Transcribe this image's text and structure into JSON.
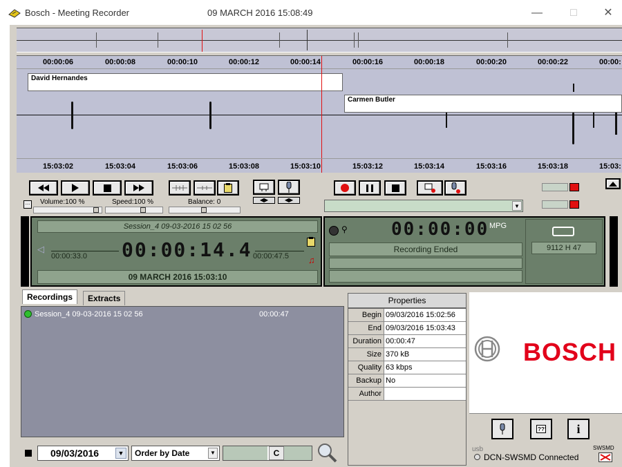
{
  "window": {
    "title": "Bosch - Meeting Recorder",
    "datetime": "09 MARCH 2016 15:08:49",
    "minimize": "—",
    "maximize": "□",
    "close": "✕"
  },
  "timeline": {
    "top_ticks": [
      "00:00:06",
      "00:00:08",
      "00:00:10",
      "00:00:12",
      "00:00:14",
      "00:00:16",
      "00:00:18",
      "00:00:20",
      "00:00:22",
      "00:00:"
    ],
    "bottom_ticks": [
      "15:03:02",
      "15:03:04",
      "15:03:06",
      "15:03:08",
      "15:03:10",
      "15:03:12",
      "15:03:14",
      "15:03:16",
      "15:03:18",
      "15:03:"
    ],
    "speakers": [
      "David Hernandes",
      "Carmen Butler"
    ]
  },
  "playback": {
    "volume_label": "Volume:100 %",
    "speed_label": "Speed:100 %",
    "balance_label": "Balance: 0",
    "ellipsis": "..."
  },
  "player": {
    "session": "Session_4  09-03-2016 15 02 56",
    "time_left": "00:00:33.0",
    "time_main": "00:00:14.4",
    "time_right": "00:00:47.5",
    "date_line": "09 MARCH 2016 15:03:10"
  },
  "recorder": {
    "time": "00:00:00",
    "format": "MPG",
    "status": "Recording Ended",
    "disk": "9112 H 47"
  },
  "tabs": [
    "Recordings",
    "Extracts"
  ],
  "recordings": [
    {
      "name": "Session_4  09-03-2016 15 02 56",
      "duration": "00:00:47",
      "status_color": "#2fbf2f"
    }
  ],
  "filter": {
    "date": "09/03/2016",
    "order": "Order by Date",
    "c_label": "C"
  },
  "properties": {
    "header": "Properties",
    "rows": [
      {
        "k": "Begin",
        "v": "09/03/2016 15:02:56"
      },
      {
        "k": "End",
        "v": "09/03/2016 15:03:43"
      },
      {
        "k": "Duration",
        "v": "00:00:47"
      },
      {
        "k": "Size",
        "v": "370 kB"
      },
      {
        "k": "Quality",
        "v": "63 kbps"
      },
      {
        "k": "Backup",
        "v": "No"
      },
      {
        "k": "Author",
        "v": ""
      }
    ]
  },
  "brand": {
    "name": "BOSCH",
    "color": "#e2001a"
  },
  "status": {
    "usb": "usb",
    "connection": "DCN-SWSMD Connected",
    "badge": "SWSMD"
  },
  "info_button": "i"
}
